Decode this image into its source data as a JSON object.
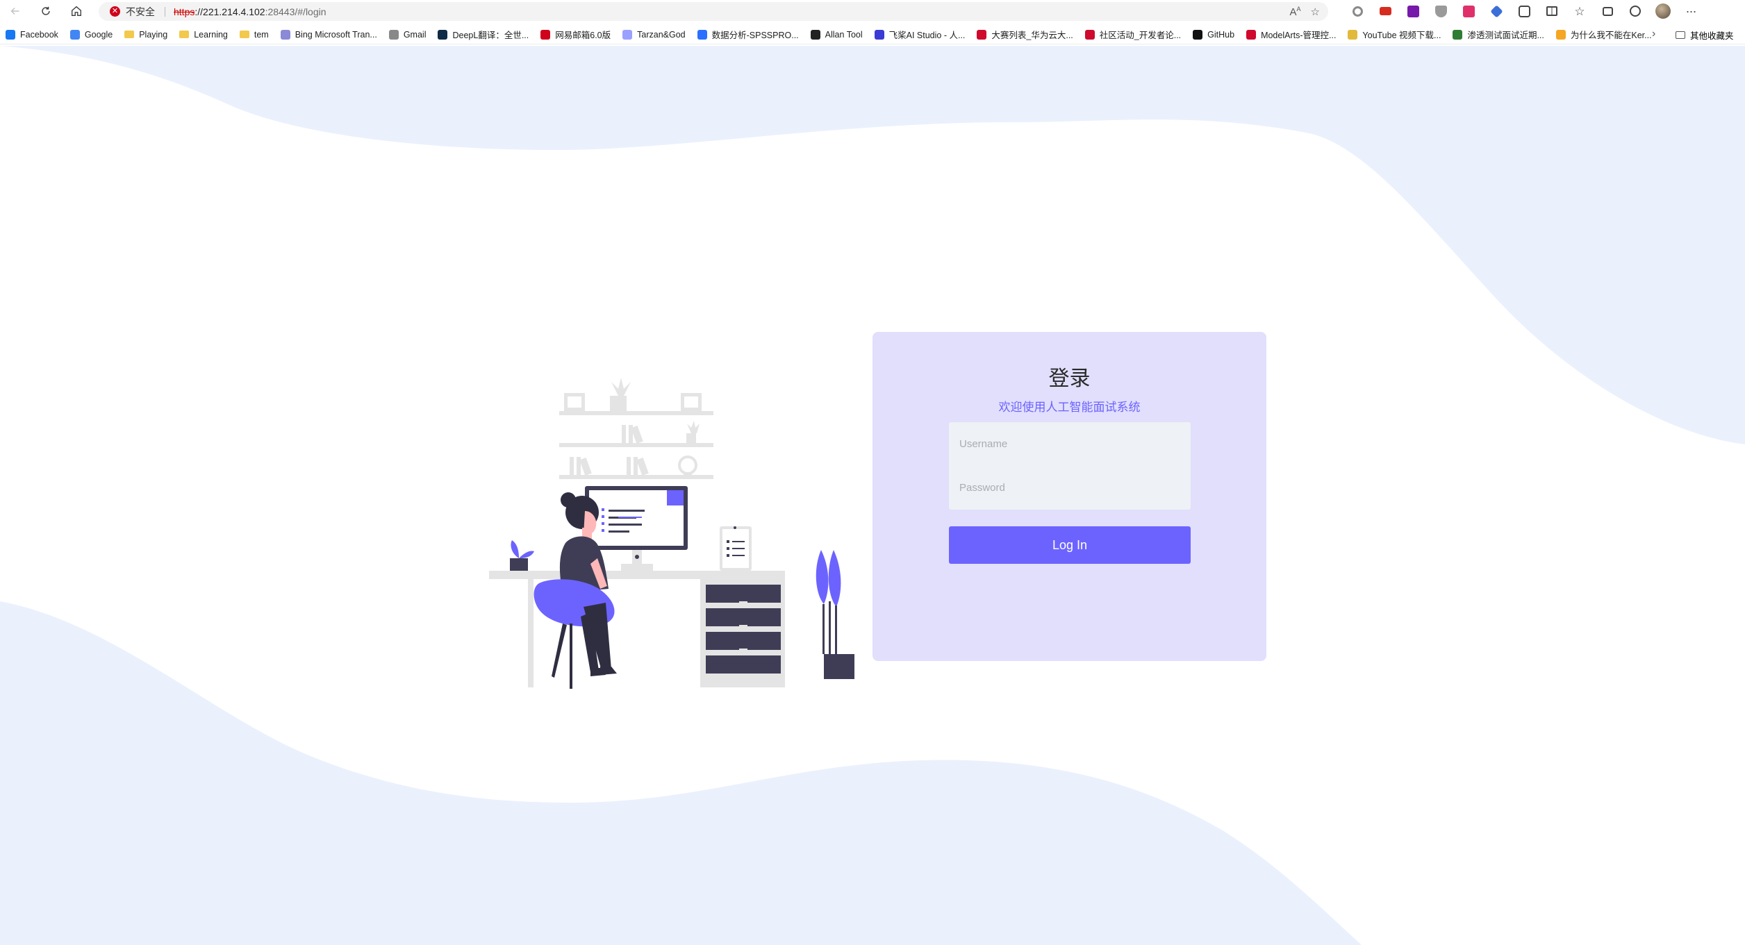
{
  "browser": {
    "address": {
      "security_label": "不安全",
      "scheme": "https",
      "host": "://221.214.4.102",
      "path": ":28443/#/login"
    },
    "bookmarks": [
      {
        "label": "Facebook",
        "icon_color": "#1877f2"
      },
      {
        "label": "Google",
        "icon_color": "#4285f4"
      },
      {
        "label": "Playing",
        "icon": "folder"
      },
      {
        "label": "Learning",
        "icon": "folder"
      },
      {
        "label": "tem",
        "icon": "folder"
      },
      {
        "label": "Bing Microsoft Tran...",
        "icon_color": "#8a8ad8"
      },
      {
        "label": "Gmail",
        "icon_color": "#888888"
      },
      {
        "label": "DeepL翻译：全世...",
        "icon_color": "#0f2b46"
      },
      {
        "label": "网易邮箱6.0版",
        "icon_color": "#d0021b"
      },
      {
        "label": "Tarzan&God",
        "icon_color": "#9aa0ff"
      },
      {
        "label": "数据分析-SPSSPRO...",
        "icon_color": "#2b6fff"
      },
      {
        "label": "Allan Tool",
        "icon_color": "#222222"
      },
      {
        "label": "飞桨AI Studio - 人...",
        "icon_color": "#3b3bd6"
      },
      {
        "label": "大赛列表_华为云大...",
        "icon_color": "#cf0a2c"
      },
      {
        "label": "社区活动_开发者论...",
        "icon_color": "#cf0a2c"
      },
      {
        "label": "GitHub",
        "icon_color": "#111111"
      },
      {
        "label": "ModelArts-管理控...",
        "icon_color": "#cf0a2c"
      },
      {
        "label": "YouTube 视频下载...",
        "icon_color": "#e2b93b"
      },
      {
        "label": "渗透测试面试近期...",
        "icon_color": "#2e7d32"
      },
      {
        "label": "为什么我不能在Ker...",
        "icon_color": "#f5a623"
      }
    ],
    "other_bookmarks": "其他收藏夹"
  },
  "login": {
    "title": "登录",
    "subtitle": "欢迎使用人工智能面试系统",
    "username_placeholder": "Username",
    "password_placeholder": "Password",
    "button_label": "Log In"
  },
  "colors": {
    "accent": "#6c63ff",
    "card": "#e1dffc",
    "wave": "#eaf1fd"
  }
}
